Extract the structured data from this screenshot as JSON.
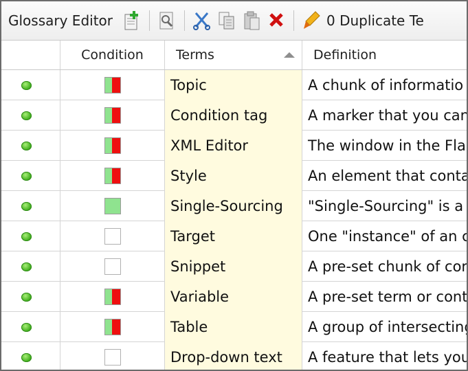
{
  "toolbar": {
    "title": "Glossary Editor",
    "duplicate_label": "0 Duplicate Te",
    "buttons": [
      {
        "icon": "add-term-icon"
      },
      {
        "icon": "properties-icon"
      },
      {
        "icon": "cut-icon"
      },
      {
        "icon": "copy-icon"
      },
      {
        "icon": "paste-icon"
      },
      {
        "icon": "delete-icon"
      },
      {
        "icon": "highlight-duplicates-icon"
      }
    ]
  },
  "table": {
    "columns": {
      "condition": "Condition",
      "terms": "Terms",
      "definition": "Definition"
    },
    "sort": {
      "column": "terms",
      "direction": "ascending"
    },
    "colors": {
      "status_dot": "#3fae1b",
      "condition_green": "#8fe38f",
      "condition_red": "#ee0f0f",
      "term_bg": "#fffbdf"
    },
    "rows": [
      {
        "condition": "split",
        "term": "Topic",
        "definition": "A chunk of informatio"
      },
      {
        "condition": "split",
        "term": "Condition tag",
        "definition": "A marker that you can"
      },
      {
        "condition": "split",
        "term": "XML Editor",
        "definition": "The window in the Fla"
      },
      {
        "condition": "split",
        "term": "Style",
        "definition": "An element that conta"
      },
      {
        "condition": "green",
        "term": "Single-Sourcing",
        "definition": "\"Single-Sourcing\" is a"
      },
      {
        "condition": "empty",
        "term": "Target",
        "definition": "One \"instance\" of an c"
      },
      {
        "condition": "empty",
        "term": "Snippet",
        "definition": "A pre-set chunk of cor"
      },
      {
        "condition": "split",
        "term": "Variable",
        "definition": "A pre-set term or cont"
      },
      {
        "condition": "split",
        "term": "Table",
        "definition": "A group of intersecting"
      },
      {
        "condition": "empty",
        "term": "Drop-down text",
        "definition": "A feature that lets you"
      }
    ]
  }
}
